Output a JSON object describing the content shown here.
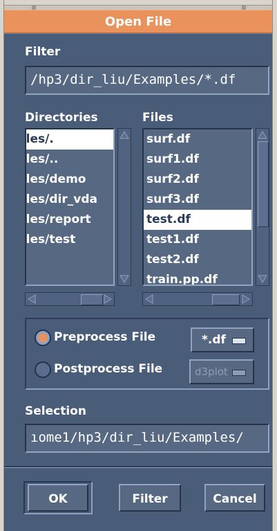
{
  "window": {
    "title": "Open File"
  },
  "filter": {
    "label": "Filter",
    "value": "/hp3/dir_liu/Examples/*.df"
  },
  "directories": {
    "label": "Directories",
    "items": [
      {
        "text": "oles/.",
        "selected": true
      },
      {
        "text": "oles/..",
        "selected": false
      },
      {
        "text": "oles/demo",
        "selected": false
      },
      {
        "text": "oles/dir_vda",
        "selected": false
      },
      {
        "text": "oles/report",
        "selected": false
      },
      {
        "text": "oles/test",
        "selected": false
      }
    ]
  },
  "files": {
    "label": "Files",
    "items": [
      {
        "text": "surf.df",
        "selected": false
      },
      {
        "text": "surf1.df",
        "selected": false
      },
      {
        "text": "surf2.df",
        "selected": false
      },
      {
        "text": "surf3.df",
        "selected": false
      },
      {
        "text": "test.df",
        "selected": true
      },
      {
        "text": "test1.df",
        "selected": false
      },
      {
        "text": "test2.df",
        "selected": false
      },
      {
        "text": "train.pp.df",
        "selected": false
      }
    ]
  },
  "process": {
    "preprocess": {
      "label": "Preprocess File",
      "selected": true,
      "option": "*.df"
    },
    "postprocess": {
      "label": "Postprocess File",
      "selected": false,
      "option": "d3plot"
    }
  },
  "selection": {
    "label": "Selection",
    "value": "ıome1/hp3/dir_liu/Examples/"
  },
  "buttons": {
    "ok": "OK",
    "filter": "Filter",
    "cancel": "Cancel"
  },
  "colors": {
    "title_bar": "#e9925c",
    "panel": "#495d79",
    "accent_radio": "#e9925c"
  }
}
